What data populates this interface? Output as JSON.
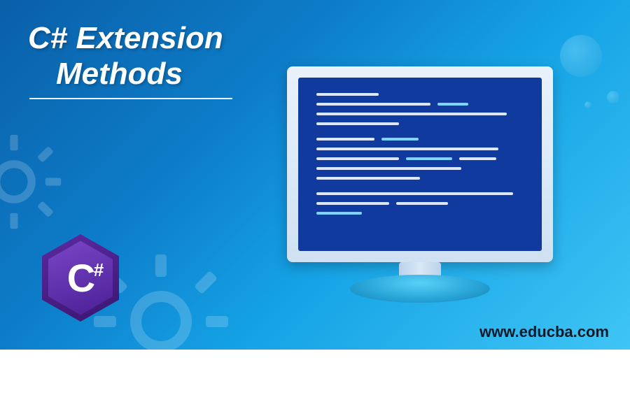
{
  "title": {
    "line1": "C# Extension",
    "line2": "Methods"
  },
  "logo": {
    "letter": "C",
    "symbol": "#"
  },
  "website": "www.educba.com"
}
